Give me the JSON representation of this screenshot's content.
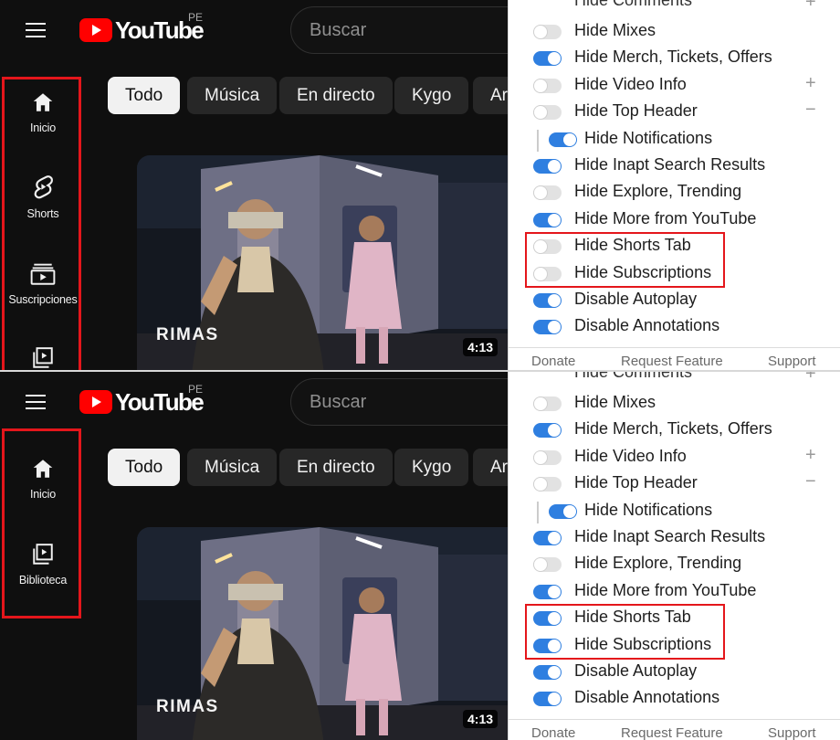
{
  "youtube": {
    "hamburger_icon": "menu-icon",
    "logo_text": "YouTube",
    "country_code": "PE",
    "search_placeholder": "Buscar",
    "chips": [
      "Todo",
      "Música",
      "En directo",
      "Kygo",
      "Ar"
    ],
    "video": {
      "watermark": "RIMAS",
      "duration": "4:13"
    }
  },
  "sidebar_before": [
    {
      "label": "Inicio",
      "icon": "home-icon"
    },
    {
      "label": "Shorts",
      "icon": "shorts-icon"
    },
    {
      "label": "Suscripciones",
      "icon": "subscriptions-icon"
    },
    {
      "label": "",
      "icon": "library-icon"
    }
  ],
  "sidebar_after": [
    {
      "label": "Inicio",
      "icon": "home-icon"
    },
    {
      "label": "Biblioteca",
      "icon": "library-icon"
    }
  ],
  "extension": {
    "cut_top_label": "Hide Comments",
    "options": [
      {
        "label": "Hide Mixes"
      },
      {
        "label": "Hide Merch, Tickets, Offers"
      },
      {
        "label": "Hide Video Info",
        "expander": "+"
      },
      {
        "label": "Hide Top Header",
        "expander": "−"
      },
      {
        "label": "Hide Notifications"
      },
      {
        "label": "Hide Inapt Search Results"
      },
      {
        "label": "Hide Explore, Trending"
      },
      {
        "label": "Hide More from YouTube"
      },
      {
        "label": "Hide Shorts Tab"
      },
      {
        "label": "Hide Subscriptions"
      },
      {
        "label": "Disable Autoplay"
      },
      {
        "label": "Disable Annotations"
      }
    ],
    "states_before": [
      false,
      true,
      false,
      false,
      true,
      true,
      false,
      true,
      false,
      false,
      true,
      true
    ],
    "states_after": [
      false,
      true,
      false,
      false,
      true,
      true,
      false,
      true,
      true,
      true,
      true,
      true
    ],
    "footer": {
      "donate": "Donate",
      "request": "Request Feature",
      "support": "Support"
    }
  },
  "colors": {
    "toggle_on": "#2f7fe0",
    "toggle_off": "#e2e2e2",
    "highlight": "#e4161b",
    "yt_bg": "#0f0f0f"
  }
}
